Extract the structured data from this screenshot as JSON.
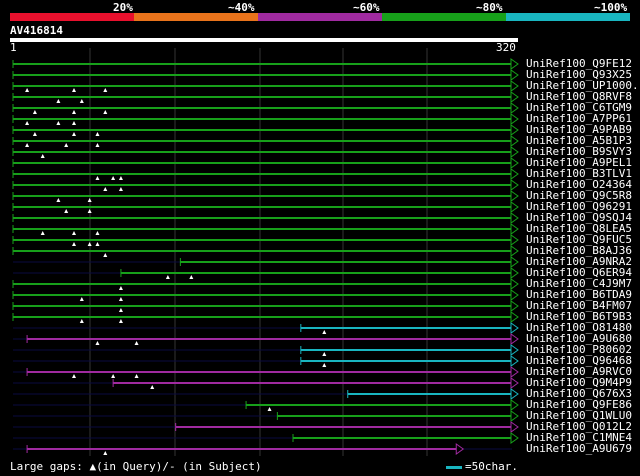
{
  "scale": {
    "labels": [
      "20%",
      "~40%",
      "~60%",
      "~80%",
      "~100%"
    ],
    "colors": [
      "#e8102d",
      "#e8731b",
      "#a02aa0",
      "#17a01a",
      "#19b5c0"
    ]
  },
  "query": {
    "name": "AV416814",
    "start": "1",
    "end": "320"
  },
  "legend": {
    "gaps": "Large gaps: ▲(in Query)/- (in Subject)",
    "scale_text": "=50char."
  },
  "hits": [
    {
      "name": "UniRef100_Q9FE12",
      "color": "green",
      "start": 1,
      "end": 320,
      "marks": []
    },
    {
      "name": "UniRef100_Q93X25",
      "color": "green",
      "start": 1,
      "end": 320,
      "marks": []
    },
    {
      "name": "UniRef100_UP1000..",
      "color": "green",
      "start": 1,
      "end": 320,
      "marks": [
        10,
        40,
        60
      ]
    },
    {
      "name": "UniRef100_Q8RVF8",
      "color": "green",
      "start": 1,
      "end": 320,
      "marks": [
        30,
        45
      ]
    },
    {
      "name": "UniRef100_C6TGM9",
      "color": "green",
      "start": 1,
      "end": 320,
      "marks": [
        15,
        40,
        60
      ]
    },
    {
      "name": "UniRef100_A7PP61",
      "color": "green",
      "start": 1,
      "end": 320,
      "marks": [
        10,
        30,
        40
      ]
    },
    {
      "name": "UniRef100_A9PAB9",
      "color": "green",
      "start": 1,
      "end": 320,
      "marks": [
        15,
        40,
        55
      ]
    },
    {
      "name": "UniRef100_A5B1P3",
      "color": "green",
      "start": 1,
      "end": 320,
      "marks": [
        10,
        35,
        55
      ]
    },
    {
      "name": "UniRef100_B9SVY3",
      "color": "green",
      "start": 1,
      "end": 320,
      "marks": [
        20
      ]
    },
    {
      "name": "UniRef100_A9PEL1",
      "color": "green",
      "start": 1,
      "end": 320,
      "marks": []
    },
    {
      "name": "UniRef100_B3TLV1",
      "color": "green",
      "start": 1,
      "end": 320,
      "marks": [
        55,
        65,
        70
      ]
    },
    {
      "name": "UniRef100_O24364",
      "color": "green",
      "start": 1,
      "end": 320,
      "marks": [
        60,
        70
      ]
    },
    {
      "name": "UniRef100_Q9C5R8",
      "color": "green",
      "start": 1,
      "end": 320,
      "marks": [
        30,
        50
      ]
    },
    {
      "name": "UniRef100_Q96291",
      "color": "green",
      "start": 1,
      "end": 320,
      "marks": [
        35,
        50
      ]
    },
    {
      "name": "UniRef100_Q9SQJ4",
      "color": "green",
      "start": 1,
      "end": 320,
      "marks": []
    },
    {
      "name": "UniRef100_Q8LEA5",
      "color": "green",
      "start": 1,
      "end": 320,
      "marks": [
        20,
        40,
        55
      ]
    },
    {
      "name": "UniRef100_Q9FUC5",
      "color": "green",
      "start": 1,
      "end": 320,
      "marks": [
        40,
        50,
        55
      ]
    },
    {
      "name": "UniRef100_B8AJ36",
      "color": "green",
      "start": 1,
      "end": 320,
      "marks": [
        60
      ]
    },
    {
      "name": "UniRef100_A9NRA2",
      "color": "green",
      "start": 108,
      "end": 320,
      "marks": []
    },
    {
      "name": "UniRef100_Q6ER94",
      "color": "green",
      "start": 70,
      "end": 320,
      "marks": [
        100,
        115
      ]
    },
    {
      "name": "UniRef100_C4J9M7",
      "color": "green",
      "start": 1,
      "end": 320,
      "marks": [
        70
      ]
    },
    {
      "name": "UniRef100_B6TDA9",
      "color": "green",
      "start": 1,
      "end": 320,
      "marks": [
        45,
        70
      ]
    },
    {
      "name": "UniRef100_B4FM07",
      "color": "green",
      "start": 1,
      "end": 320,
      "marks": [
        70
      ]
    },
    {
      "name": "UniRef100_B6T9B3",
      "color": "green",
      "start": 1,
      "end": 320,
      "marks": [
        45,
        70
      ]
    },
    {
      "name": "UniRef100_O81480",
      "color": "cyan",
      "start": 185,
      "end": 320,
      "marks": [
        200
      ]
    },
    {
      "name": "UniRef100_A9U680",
      "color": "magenta",
      "start": 10,
      "end": 320,
      "marks": [
        55,
        80
      ]
    },
    {
      "name": "UniRef100_P80602",
      "color": "cyan",
      "start": 185,
      "end": 320,
      "marks": [
        200
      ]
    },
    {
      "name": "UniRef100_Q96468",
      "color": "cyan",
      "start": 185,
      "end": 320,
      "marks": [
        200
      ]
    },
    {
      "name": "UniRef100_A9RVC0",
      "color": "magenta",
      "start": 10,
      "end": 320,
      "marks": [
        40,
        65,
        80
      ]
    },
    {
      "name": "UniRef100_Q9M4P9",
      "color": "magenta",
      "start": 65,
      "end": 320,
      "marks": [
        90
      ]
    },
    {
      "name": "UniRef100_Q676X3",
      "color": "cyan",
      "start": 215,
      "end": 320,
      "marks": []
    },
    {
      "name": "UniRef100_Q9FE86",
      "color": "green",
      "start": 150,
      "end": 320,
      "marks": [
        165
      ]
    },
    {
      "name": "UniRef100_Q1WLU0",
      "color": "green",
      "start": 170,
      "end": 320,
      "marks": []
    },
    {
      "name": "UniRef100_Q012L2",
      "color": "magenta",
      "start": 105,
      "end": 320,
      "marks": []
    },
    {
      "name": "UniRef100_C1MNE4",
      "color": "green",
      "start": 180,
      "end": 320,
      "marks": []
    },
    {
      "name": "UniRef100_A9U679",
      "color": "magenta",
      "start": 10,
      "end": 285,
      "marks": [
        60
      ]
    }
  ]
}
